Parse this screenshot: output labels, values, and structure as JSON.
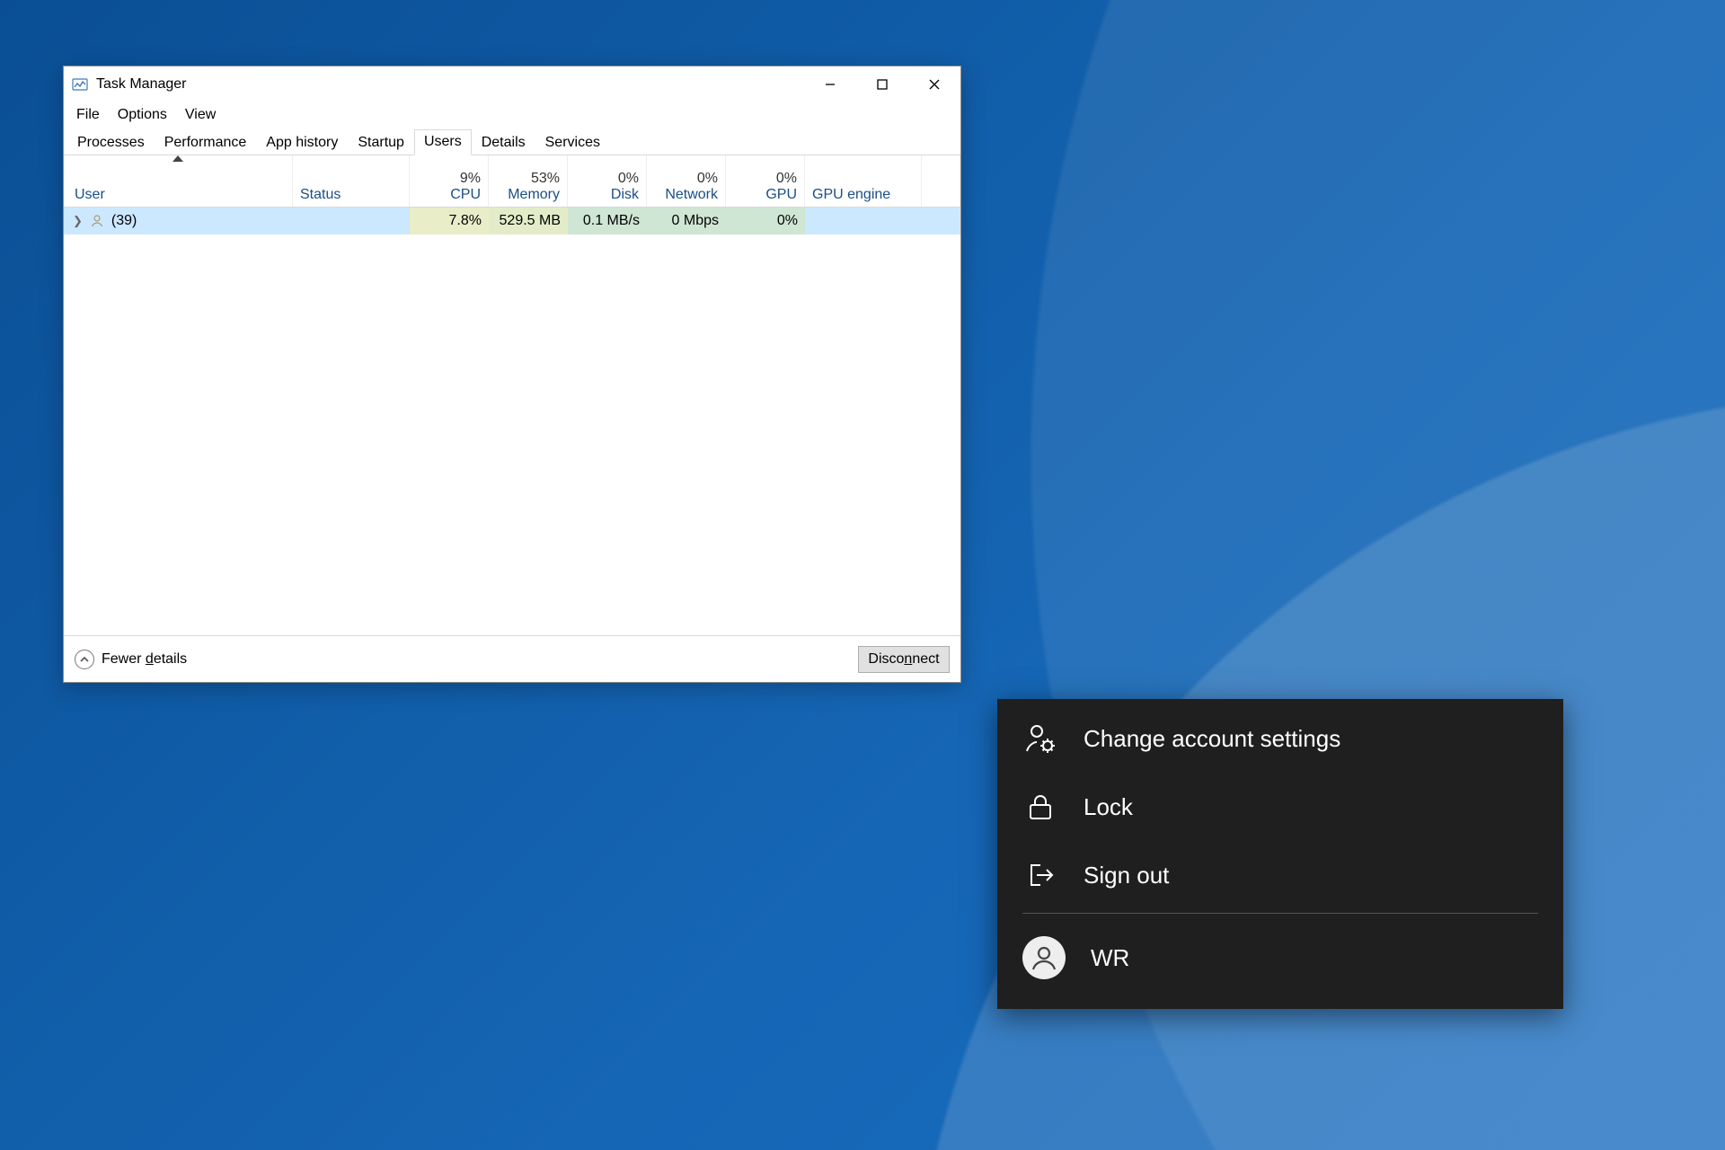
{
  "taskmgr": {
    "title": "Task Manager",
    "menus": [
      "File",
      "Options",
      "View"
    ],
    "tabs": [
      "Processes",
      "Performance",
      "App history",
      "Startup",
      "Users",
      "Details",
      "Services"
    ],
    "active_tab_index": 4,
    "columns": {
      "user": "User",
      "status": "Status",
      "cpu": {
        "pct": "9%",
        "label": "CPU"
      },
      "memory": {
        "pct": "53%",
        "label": "Memory"
      },
      "disk": {
        "pct": "0%",
        "label": "Disk"
      },
      "network": {
        "pct": "0%",
        "label": "Network"
      },
      "gpu": {
        "pct": "0%",
        "label": "GPU"
      },
      "gpu_engine": "GPU engine"
    },
    "rows": [
      {
        "name": "(39)",
        "status": "",
        "cpu": "7.8%",
        "memory": "529.5 MB",
        "disk": "0.1 MB/s",
        "network": "0 Mbps",
        "gpu": "0%",
        "gpu_engine": ""
      }
    ],
    "footer": {
      "fewer": "Fewer ",
      "fewer_u": "d",
      "fewer_tail": "etails",
      "disconnect_pre": "Disco",
      "disconnect_u": "n",
      "disconnect_post": "nect"
    }
  },
  "startmenu": {
    "items": [
      {
        "icon": "person-gear",
        "label": "Change account settings"
      },
      {
        "icon": "lock",
        "label": "Lock"
      },
      {
        "icon": "signout",
        "label": "Sign out"
      }
    ],
    "user": {
      "initials": "WR"
    }
  }
}
